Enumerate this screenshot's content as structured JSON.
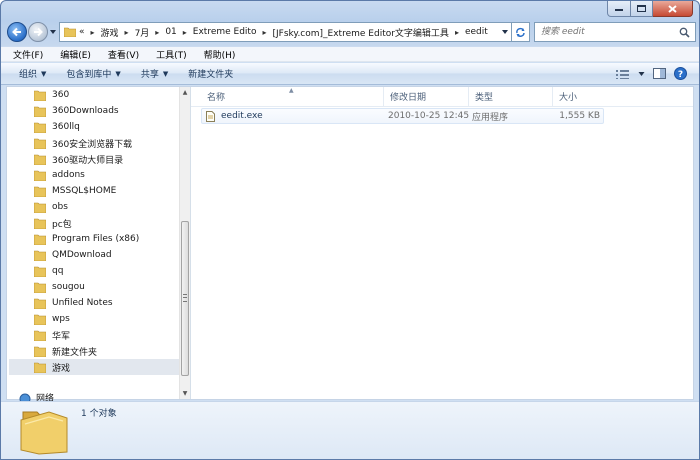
{
  "colors": {
    "accent": "#2a6fc9",
    "folder": "#e8c45a",
    "close": "#c74a33"
  },
  "address": {
    "crumbs": [
      "«",
      "游戏",
      "7月",
      "01",
      "Extreme Edito",
      "[JFsky.com]_Extreme Editor文字编辑工具",
      "eedit"
    ]
  },
  "search": {
    "placeholder": "搜索 eedit"
  },
  "menu": [
    "文件(F)",
    "编辑(E)",
    "查看(V)",
    "工具(T)",
    "帮助(H)"
  ],
  "commands": [
    {
      "label": "组织",
      "dropdown": true
    },
    {
      "label": "包含到库中",
      "dropdown": true
    },
    {
      "label": "共享",
      "dropdown": true
    },
    {
      "label": "新建文件夹",
      "dropdown": false
    }
  ],
  "tree": [
    "360",
    "360Downloads",
    "360llq",
    "360安全浏览器下载",
    "360驱动大师目录",
    "addons",
    "MSSQL$HOME",
    "obs",
    "pc包",
    "Program Files (x86)",
    "QMDownload",
    "qq",
    "sougou",
    "Unfiled Notes",
    "wps",
    "华军",
    "新建文件夹",
    "游戏"
  ],
  "tree_selected_index": 17,
  "network_label": "网络",
  "columns": {
    "name": "名称",
    "modified": "修改日期",
    "type": "类型",
    "size": "大小"
  },
  "files": [
    {
      "name": "eedit.exe",
      "modified": "2010-10-25 12:45",
      "type": "应用程序",
      "size": "1,555 KB"
    }
  ],
  "status": "1 个对象"
}
